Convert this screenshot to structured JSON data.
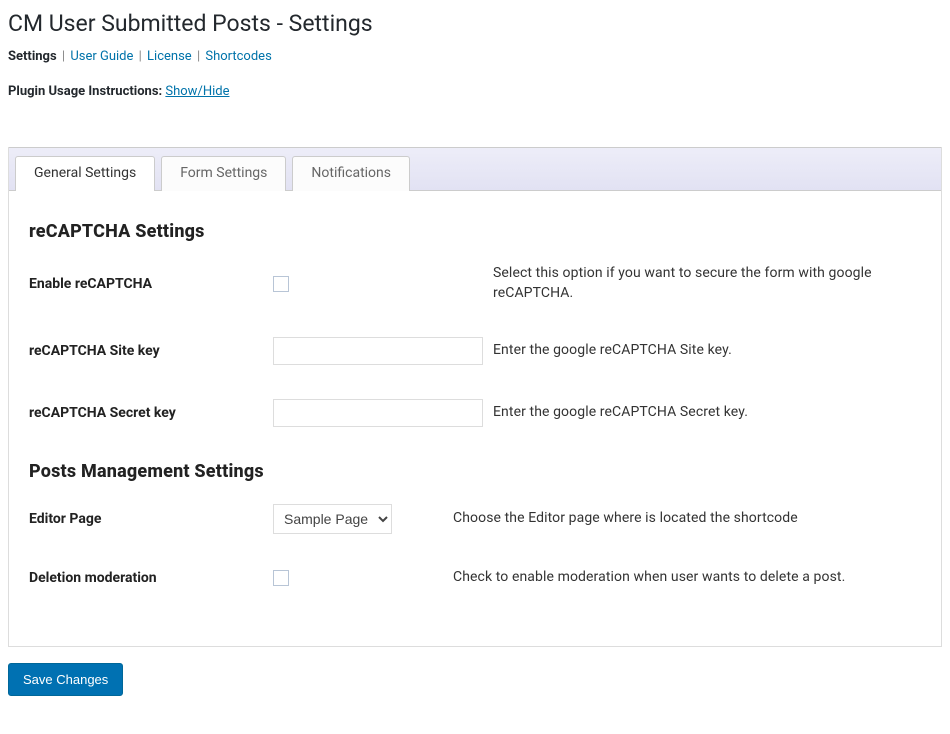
{
  "page_title": "CM User Submitted Posts - Settings",
  "nav": {
    "current": "Settings",
    "links": [
      "User Guide",
      "License",
      "Shortcodes"
    ]
  },
  "usage": {
    "label": "Plugin Usage Instructions: ",
    "toggle": "Show/Hide"
  },
  "tabs": [
    {
      "label": "General Settings",
      "active": true
    },
    {
      "label": "Form Settings",
      "active": false
    },
    {
      "label": "Notifications",
      "active": false
    }
  ],
  "sections": {
    "recaptcha": {
      "title": "reCAPTCHA Settings",
      "enable": {
        "label": "Enable reCAPTCHA",
        "desc": "Select this option if you want to secure the form with google reCAPTCHA."
      },
      "site_key": {
        "label": "reCAPTCHA Site key",
        "value": "",
        "desc": "Enter the google reCAPTCHA Site key."
      },
      "secret_key": {
        "label": "reCAPTCHA Secret key",
        "value": "",
        "desc": "Enter the google reCAPTCHA Secret key."
      }
    },
    "posts": {
      "title": "Posts Management Settings",
      "editor_page": {
        "label": "Editor Page",
        "selected": "Sample Page",
        "desc": "Choose the Editor page where is located the shortcode"
      },
      "deletion": {
        "label": "Deletion moderation",
        "desc": "Check to enable moderation when user wants to delete a post."
      }
    }
  },
  "save_label": "Save Changes"
}
